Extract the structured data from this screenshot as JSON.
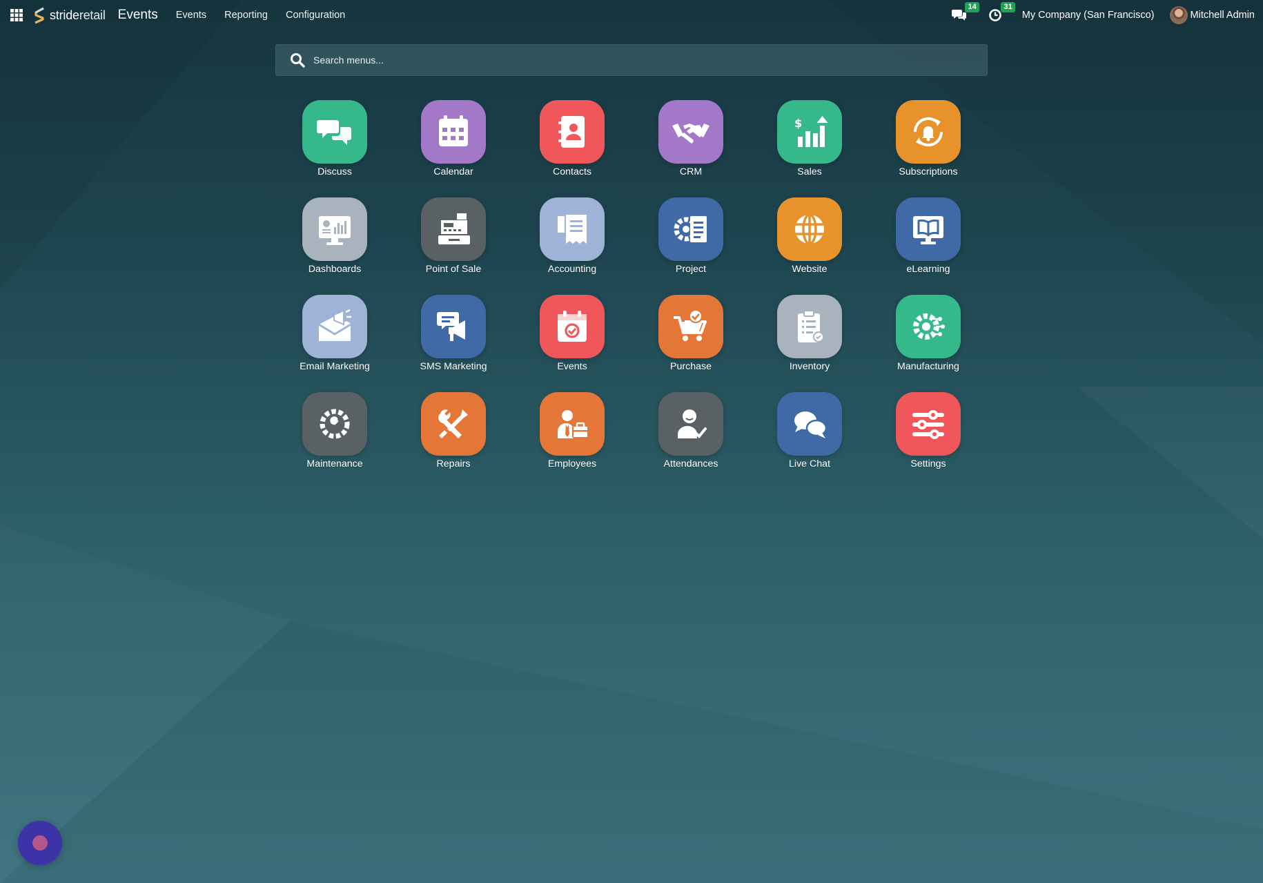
{
  "brand": {
    "part1": "stride",
    "part2": "retail"
  },
  "app_title": "Events",
  "nav": [
    "Events",
    "Reporting",
    "Configuration"
  ],
  "systray": {
    "messages_count": "14",
    "activities_count": "31"
  },
  "company": "My Company (San Francisco)",
  "user": "Mitchell Admin",
  "search": {
    "placeholder": "Search menus..."
  },
  "apps": [
    {
      "label": "Discuss",
      "icon": "discuss-icon",
      "color": "#35b98a"
    },
    {
      "label": "Calendar",
      "icon": "calendar-icon",
      "color": "#a378c9"
    },
    {
      "label": "Contacts",
      "icon": "contacts-icon",
      "color": "#f0575b"
    },
    {
      "label": "CRM",
      "icon": "handshake-icon",
      "color": "#a378c9"
    },
    {
      "label": "Sales",
      "icon": "sales-chart-icon",
      "color": "#35b98a"
    },
    {
      "label": "Subscriptions",
      "icon": "subscriptions-icon",
      "color": "#e8922b"
    },
    {
      "label": "Dashboards",
      "icon": "dashboard-monitor-icon",
      "color": "#a9b3bd"
    },
    {
      "label": "Point of Sale",
      "icon": "cash-register-icon",
      "color": "#5a6165"
    },
    {
      "label": "Accounting",
      "icon": "accounting-receipt-icon",
      "color": "#9fb3d6"
    },
    {
      "label": "Project",
      "icon": "project-gear-icon",
      "color": "#3f6aa6"
    },
    {
      "label": "Website",
      "icon": "globe-icon",
      "color": "#e8922b"
    },
    {
      "label": "eLearning",
      "icon": "elearning-book-icon",
      "color": "#3f6aa6"
    },
    {
      "label": "Email Marketing",
      "icon": "email-marketing-icon",
      "color": "#9fb3d6"
    },
    {
      "label": "SMS Marketing",
      "icon": "sms-megaphone-icon",
      "color": "#3f6aa6"
    },
    {
      "label": "Events",
      "icon": "events-calendar-icon",
      "color": "#f0575b"
    },
    {
      "label": "Purchase",
      "icon": "purchase-cart-icon",
      "color": "#e47638"
    },
    {
      "label": "Inventory",
      "icon": "inventory-clipboard-icon",
      "color": "#a9b3bd"
    },
    {
      "label": "Manufacturing",
      "icon": "manufacturing-gear-icon",
      "color": "#35b98a"
    },
    {
      "label": "Maintenance",
      "icon": "maintenance-wrench-icon",
      "color": "#5a6165"
    },
    {
      "label": "Repairs",
      "icon": "repairs-tools-icon",
      "color": "#e47638"
    },
    {
      "label": "Employees",
      "icon": "employees-icon",
      "color": "#e47638"
    },
    {
      "label": "Attendances",
      "icon": "attendances-user-icon",
      "color": "#5a6165"
    },
    {
      "label": "Live Chat",
      "icon": "live-chat-icon",
      "color": "#3f6aa6"
    },
    {
      "label": "Settings",
      "icon": "settings-sliders-icon",
      "color": "#f0575b"
    }
  ]
}
